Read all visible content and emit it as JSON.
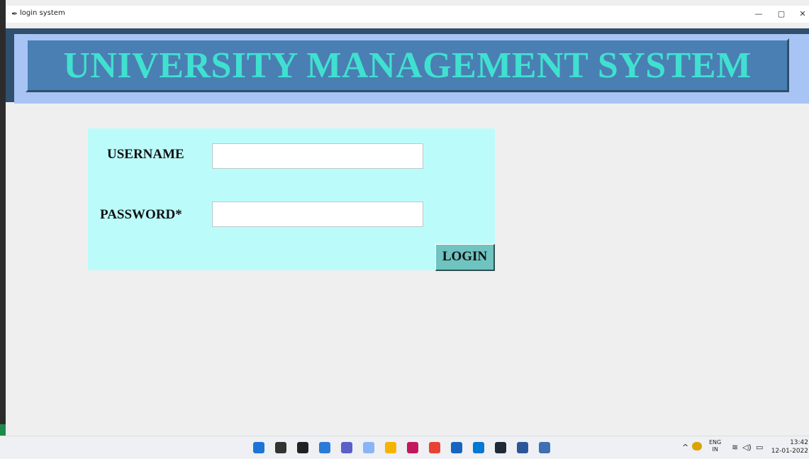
{
  "window": {
    "title": "login system",
    "controls": {
      "minimize": "—",
      "maximize": "▢",
      "close": "✕"
    }
  },
  "banner": {
    "title": "UNIVERSITY MANAGEMENT SYSTEM"
  },
  "login": {
    "username_label": "USERNAME",
    "username_value": "",
    "password_label": "PASSWORD*",
    "password_value": "",
    "login_button": "LOGIN"
  },
  "taskbar": {
    "icons": [
      {
        "name": "start-icon",
        "color": "#1f74d8"
      },
      {
        "name": "search-icon",
        "color": "#333333"
      },
      {
        "name": "task-view-icon",
        "color": "#222222"
      },
      {
        "name": "widgets-icon",
        "color": "#2a7bd8"
      },
      {
        "name": "chat-icon",
        "color": "#5b5fc7"
      },
      {
        "name": "photos-icon",
        "color": "#8ab4f8"
      },
      {
        "name": "file-explorer-icon",
        "color": "#f4b400"
      },
      {
        "name": "jetbrains-icon",
        "color": "#c2185b"
      },
      {
        "name": "chrome-icon",
        "color": "#e94235"
      },
      {
        "name": "mail-icon",
        "color": "#1565c0"
      },
      {
        "name": "vscode-icon",
        "color": "#0078d4"
      },
      {
        "name": "terminal-icon",
        "color": "#1e2a3a"
      },
      {
        "name": "word-icon",
        "color": "#2b579a"
      },
      {
        "name": "python-app-icon",
        "color": "#3f6fb5"
      }
    ],
    "tray": {
      "language_top": "ENG",
      "language_bottom": "IN",
      "time": "13:42",
      "date": "12-01-2022"
    }
  }
}
